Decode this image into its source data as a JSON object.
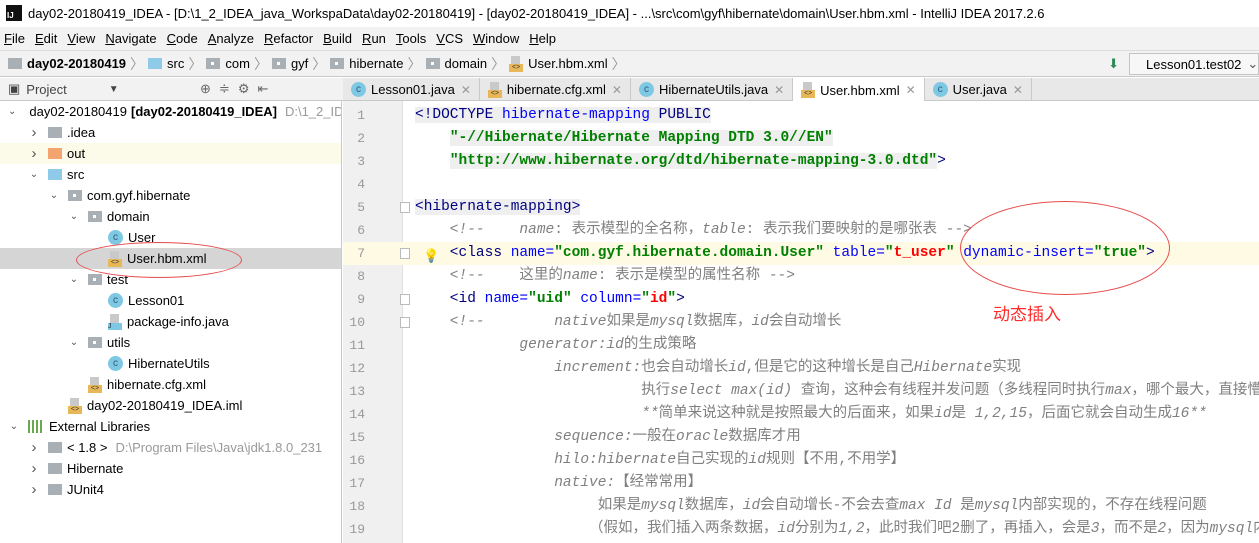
{
  "window": {
    "title": "day02-20180419_IDEA - [D:\\1_2_IDEA_java_WorkspaData\\day02-20180419] - [day02-20180419_IDEA] - ...\\src\\com\\gyf\\hibernate\\domain\\User.hbm.xml - IntelliJ IDEA 2017.2.6",
    "logo": "IJ"
  },
  "menu": [
    "File",
    "Edit",
    "View",
    "Navigate",
    "Code",
    "Analyze",
    "Refactor",
    "Build",
    "Run",
    "Tools",
    "VCS",
    "Window",
    "Help"
  ],
  "breadcrumb": [
    {
      "label": "day02-20180419",
      "icon": "project-folder-icon"
    },
    {
      "label": "src",
      "icon": "source-folder-icon"
    },
    {
      "label": "com",
      "icon": "package-icon"
    },
    {
      "label": "gyf",
      "icon": "package-icon"
    },
    {
      "label": "hibernate",
      "icon": "package-icon"
    },
    {
      "label": "domain",
      "icon": "package-icon"
    },
    {
      "label": "User.hbm.xml",
      "icon": "xml-file-icon"
    }
  ],
  "run_config": {
    "label": "Lesson01.test02"
  },
  "project_panel": {
    "title": "Project"
  },
  "tabs": [
    {
      "label": "Lesson01.java",
      "icon": "class",
      "active": false
    },
    {
      "label": "hibernate.cfg.xml",
      "icon": "xml",
      "active": false
    },
    {
      "label": "HibernateUtils.java",
      "icon": "class",
      "active": false
    },
    {
      "label": "User.hbm.xml",
      "icon": "xml",
      "active": true
    },
    {
      "label": "User.java",
      "icon": "class",
      "active": false
    }
  ],
  "tree": [
    {
      "depth": 0,
      "chev": "down",
      "icon": "project",
      "label": "day02-20180419",
      "bold": "[day02-20180419_IDEA]",
      "extra": "D:\\1_2_ID"
    },
    {
      "depth": 1,
      "chev": "right",
      "icon": "folder",
      "label": ".idea"
    },
    {
      "depth": 1,
      "chev": "right",
      "icon": "folder-orange",
      "label": "out",
      "state": "highlighted"
    },
    {
      "depth": 1,
      "chev": "down",
      "icon": "folder-blue",
      "label": "src"
    },
    {
      "depth": 2,
      "chev": "down",
      "icon": "package",
      "label": "com.gyf.hibernate"
    },
    {
      "depth": 3,
      "chev": "down",
      "icon": "package",
      "label": "domain"
    },
    {
      "depth": 4,
      "chev": "",
      "icon": "class",
      "label": "User"
    },
    {
      "depth": 4,
      "chev": "",
      "icon": "xml",
      "label": "User.hbm.xml",
      "state": "selected"
    },
    {
      "depth": 3,
      "chev": "down",
      "icon": "package",
      "label": "test"
    },
    {
      "depth": 4,
      "chev": "",
      "icon": "class",
      "label": "Lesson01"
    },
    {
      "depth": 4,
      "chev": "",
      "icon": "java",
      "label": "package-info.java"
    },
    {
      "depth": 3,
      "chev": "down",
      "icon": "package",
      "label": "utils"
    },
    {
      "depth": 4,
      "chev": "",
      "icon": "class",
      "label": "HibernateUtils"
    },
    {
      "depth": 3,
      "chev": "",
      "icon": "xml",
      "label": "hibernate.cfg.xml"
    },
    {
      "depth": 2,
      "chev": "",
      "icon": "iml",
      "label": "day02-20180419_IDEA.iml"
    },
    {
      "depth": 0,
      "chev": "down",
      "icon": "library",
      "label": "External Libraries"
    },
    {
      "depth": 1,
      "chev": "right",
      "icon": "jdk",
      "label": "< 1.8 >",
      "extra": "D:\\Program Files\\Java\\jdk1.8.0_231"
    },
    {
      "depth": 1,
      "chev": "right",
      "icon": "library-folder",
      "label": "Hibernate"
    },
    {
      "depth": 1,
      "chev": "right",
      "icon": "library-folder",
      "label": "JUnit4"
    }
  ],
  "code": [
    {
      "n": "1",
      "tokens": [
        [
          "<!DOCTYPE ",
          "tag doc"
        ],
        [
          "hibernate-mapping",
          "attr doc"
        ],
        [
          " PUBLIC",
          "tag doc"
        ]
      ]
    },
    {
      "n": "2",
      "tokens": [
        [
          "    ",
          ""
        ],
        [
          "\"-//Hibernate/Hibernate Mapping DTD 3.0//EN\"",
          "str doc"
        ]
      ]
    },
    {
      "n": "3",
      "tokens": [
        [
          "    ",
          ""
        ],
        [
          "\"http://www.hibernate.org/dtd/hibernate-mapping-3.0.dtd\"",
          "str doc"
        ],
        [
          ">",
          "tag"
        ]
      ]
    },
    {
      "n": "4",
      "tokens": []
    },
    {
      "n": "5",
      "fold": true,
      "tokens": [
        [
          "<hibernate-mapping>",
          "tag doc"
        ]
      ]
    },
    {
      "n": "6",
      "tokens": [
        [
          "    <!--    ",
          "cmti"
        ],
        [
          "name",
          "cmti"
        ],
        [
          ": 表示模型的全名称，",
          "cmt"
        ],
        [
          "table",
          "cmti"
        ],
        [
          ": 表示我们要映射的是哪张表 -->",
          "cmt"
        ]
      ]
    },
    {
      "n": "7",
      "fold": true,
      "current": true,
      "bulb": true,
      "tokens": [
        [
          "    <class ",
          "tag"
        ],
        [
          "name=",
          "attr"
        ],
        [
          "\"com.gyf.hibernate.domain.User\"",
          "str"
        ],
        [
          " table=",
          "attr"
        ],
        [
          "\"",
          "str"
        ],
        [
          "t_user",
          "red"
        ],
        [
          "\"",
          "str"
        ],
        [
          " dynamic-insert=",
          "attr"
        ],
        [
          "\"true\"",
          "str"
        ],
        [
          ">",
          "tag"
        ]
      ]
    },
    {
      "n": "8",
      "tokens": [
        [
          "    <!--    ",
          "cmti"
        ],
        [
          "这里的",
          "cmt"
        ],
        [
          "name",
          "cmti"
        ],
        [
          ": 表示是模型的属性名称 -->",
          "cmt"
        ]
      ]
    },
    {
      "n": "9",
      "fold": true,
      "tokens": [
        [
          "    <id ",
          "tag"
        ],
        [
          "name=",
          "attr"
        ],
        [
          "\"uid\"",
          "str"
        ],
        [
          " column=",
          "attr"
        ],
        [
          "\"",
          "str"
        ],
        [
          "id",
          "red"
        ],
        [
          "\"",
          "str"
        ],
        [
          ">",
          "tag"
        ]
      ]
    },
    {
      "n": "10",
      "fold": true,
      "tokens": [
        [
          "    <!--        ",
          "cmti"
        ],
        [
          "native",
          "cmti"
        ],
        [
          "如果是",
          "cmt"
        ],
        [
          "mysql",
          "cmti"
        ],
        [
          "数据库，",
          "cmt"
        ],
        [
          "id",
          "cmti"
        ],
        [
          "会自动增长",
          "cmt"
        ]
      ]
    },
    {
      "n": "11",
      "tokens": [
        [
          "            generator:id",
          "cmti"
        ],
        [
          "的生成策略",
          "cmt"
        ]
      ]
    },
    {
      "n": "12",
      "tokens": [
        [
          "                increment:",
          "cmti"
        ],
        [
          "也会自动增长",
          "cmt"
        ],
        [
          "id",
          "cmti"
        ],
        [
          ",但是它的这种增长是自己",
          "cmt"
        ],
        [
          "Hibernate",
          "cmti"
        ],
        [
          "实现",
          "cmt"
        ]
      ]
    },
    {
      "n": "13",
      "tokens": [
        [
          "                          执行",
          "cmt"
        ],
        [
          "select max(id) ",
          "cmti"
        ],
        [
          "查询，这种会有线程并发问题（多线程同时执行",
          "cmt"
        ],
        [
          "max",
          "cmti"
        ],
        [
          "，哪个最大，直接懵逼",
          "cmt"
        ]
      ]
    },
    {
      "n": "14",
      "tokens": [
        [
          "                          **",
          "cmti"
        ],
        [
          "简单来说这种就是按照最大的后面来，如果",
          "cmt"
        ],
        [
          "id",
          "cmti"
        ],
        [
          "是 ",
          "cmt"
        ],
        [
          "1,2,15",
          "cmti"
        ],
        [
          "，后面它就会自动生成",
          "cmt"
        ],
        [
          "16**",
          "cmti"
        ]
      ]
    },
    {
      "n": "15",
      "tokens": [
        [
          "                sequence:",
          "cmti"
        ],
        [
          "一般在",
          "cmt"
        ],
        [
          "oracle",
          "cmti"
        ],
        [
          "数据库才用",
          "cmt"
        ]
      ]
    },
    {
      "n": "16",
      "tokens": [
        [
          "                hilo:hibernate",
          "cmti"
        ],
        [
          "自己实现的",
          "cmt"
        ],
        [
          "id",
          "cmti"
        ],
        [
          "规则【不用,不用学】",
          "cmt"
        ]
      ]
    },
    {
      "n": "17",
      "tokens": [
        [
          "                native:",
          "cmti"
        ],
        [
          "【经常常用】",
          "cmt"
        ]
      ]
    },
    {
      "n": "18",
      "tokens": [
        [
          "                     如果是",
          "cmt"
        ],
        [
          "mysql",
          "cmti"
        ],
        [
          "数据库，",
          "cmt"
        ],
        [
          "id",
          "cmti"
        ],
        [
          "会自动增长-不会去查",
          "cmt"
        ],
        [
          "max Id ",
          "cmti"
        ],
        [
          "是",
          "cmt"
        ],
        [
          "mysql",
          "cmti"
        ],
        [
          "内部实现的，不存在线程问题",
          "cmt"
        ]
      ]
    },
    {
      "n": "19",
      "tokens": [
        [
          "                    （假如，我们插入两条数据，",
          "cmt"
        ],
        [
          "id",
          "cmti"
        ],
        [
          "分别为",
          "cmt"
        ],
        [
          "1,2",
          "cmti"
        ],
        [
          "，此时我们吧2删了，再插入，会是",
          "cmt"
        ],
        [
          "3",
          "cmti"
        ],
        [
          "，而不是",
          "cmt"
        ],
        [
          "2",
          "cmti"
        ],
        [
          "，因为",
          "cmt"
        ],
        [
          "mysql",
          "cmti"
        ],
        [
          "内部",
          "cmt"
        ]
      ]
    }
  ],
  "annotation": {
    "text": "动态插入",
    "color": "#ff2a2a"
  }
}
